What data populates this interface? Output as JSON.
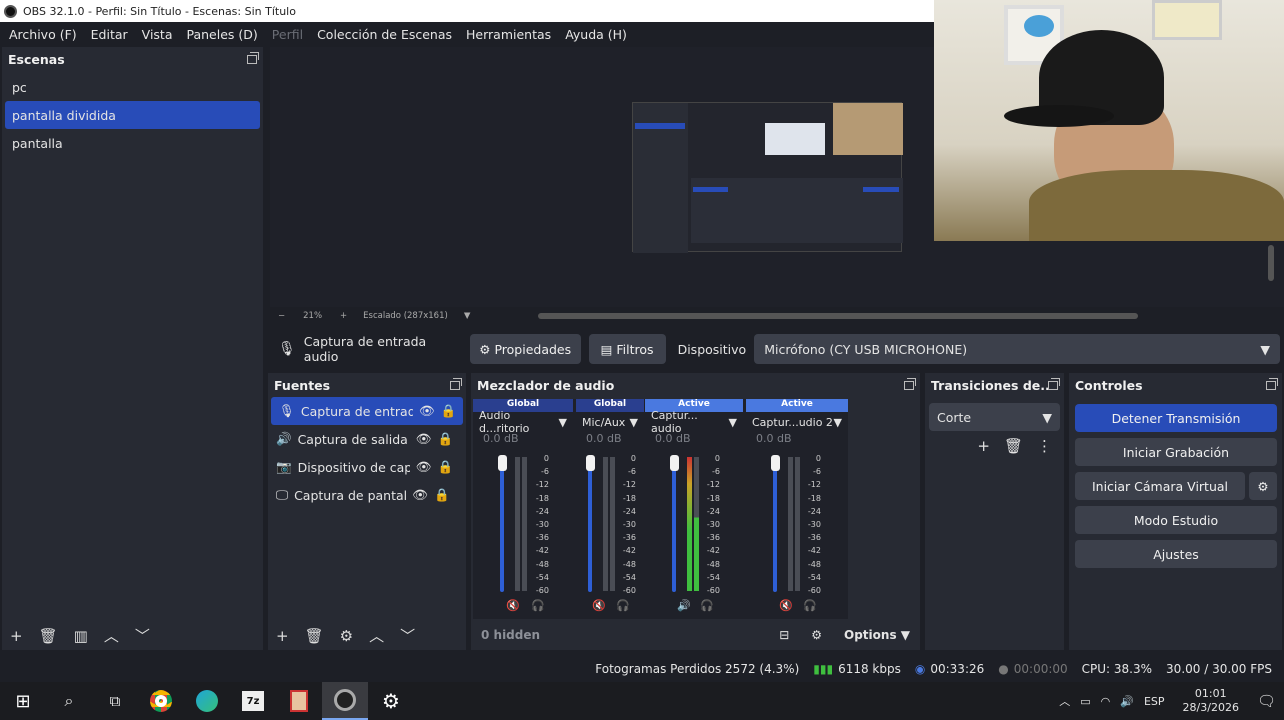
{
  "window": {
    "title": "OBS 32.1.0 - Perfil: Sin Título - Escenas: Sin Título"
  },
  "menu": [
    {
      "label": "Archivo (F)",
      "dim": false
    },
    {
      "label": "Editar",
      "dim": false
    },
    {
      "label": "Vista",
      "dim": false
    },
    {
      "label": "Paneles (D)",
      "dim": false
    },
    {
      "label": "Perfil",
      "dim": true
    },
    {
      "label": "Colección de Escenas",
      "dim": false
    },
    {
      "label": "Herramientas",
      "dim": false
    },
    {
      "label": "Ayuda (H)",
      "dim": false
    }
  ],
  "scenes": {
    "title": "Escenas",
    "items": [
      "pc",
      "pantalla dividida",
      "pantalla"
    ],
    "selected": 1
  },
  "preview": {
    "zoom": "21%",
    "scale_label": "Escalado (287x161)"
  },
  "context": {
    "source_name": "Captura de entrada audio",
    "properties": "Propiedades",
    "filters": "Filtros",
    "device_label": "Dispositivo",
    "device_value": "Micrófono (CY USB MICROHONE)"
  },
  "sources": {
    "title": "Fuentes",
    "items": [
      {
        "name": "Captura de entrada",
        "icon": "microphone-icon",
        "selected": true
      },
      {
        "name": "Captura de salida de",
        "icon": "speaker-icon",
        "selected": false
      },
      {
        "name": "Dispositivo de captu",
        "icon": "camera-icon",
        "selected": false
      },
      {
        "name": "Captura de pantalla",
        "icon": "monitor-icon",
        "selected": false
      }
    ]
  },
  "mixer": {
    "title": "Mezclador de audio",
    "channels": [
      {
        "tag": "Global",
        "name": "Audio d...ritorio",
        "db": "0.0 dB",
        "muted": true
      },
      {
        "tag": "Global",
        "name": "Mic/Aux",
        "db": "0.0 dB",
        "muted": true
      },
      {
        "tag": "Active",
        "name": "Captur... audio",
        "db": "0.0 dB",
        "muted": false
      },
      {
        "tag": "Active",
        "name": "Captur...udio 2",
        "db": "0.0 dB",
        "muted": true
      }
    ],
    "scale": [
      "0",
      "-6",
      "-12",
      "-18",
      "-24",
      "-30",
      "-36",
      "-42",
      "-48",
      "-54",
      "-60"
    ],
    "hidden_label": "0 hidden",
    "options_label": "Options",
    "colors": {
      "global": "#2a3f8f",
      "active": "#4a79e0",
      "fader": "#2e5fd6"
    }
  },
  "transitions": {
    "title": "Transiciones de...",
    "value": "Corte"
  },
  "controls": {
    "title": "Controles",
    "stop_stream": "Detener Transmisión",
    "start_record": "Iniciar Grabación",
    "virtual_cam": "Iniciar Cámara Virtual",
    "studio_mode": "Modo Estudio",
    "settings": "Ajustes"
  },
  "status": {
    "dropped": "Fotogramas Perdidos 2572 (4.3%)",
    "bitrate": "6118 kbps",
    "stream_time": "00:33:26",
    "rec_time": "00:00:00",
    "cpu": "CPU: 38.3%",
    "fps": "30.00 / 30.00 FPS"
  },
  "taskbar": {
    "lang": "ESP",
    "time": "01:01",
    "date": "28/3/2026"
  },
  "colors": {
    "accent": "#284cb8",
    "panel": "#272a33",
    "bg": "#1d1f26"
  }
}
